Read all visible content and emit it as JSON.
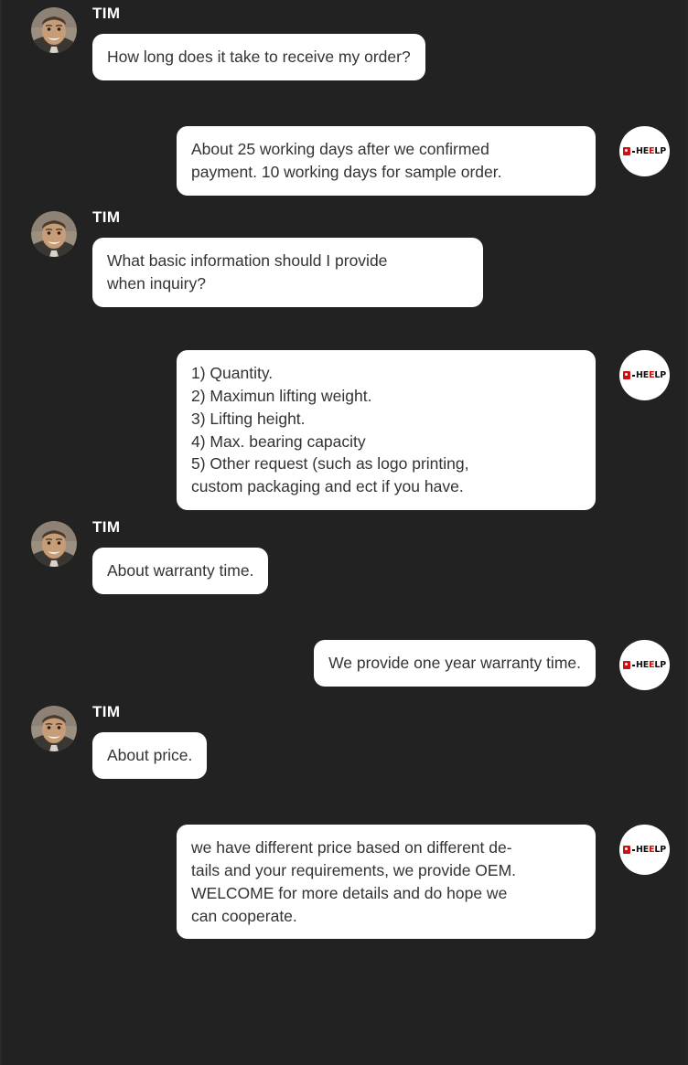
{
  "theme": {
    "background": "#222222",
    "bubble_background": "#ffffff",
    "bubble_text": "#333333",
    "sender_name_color": "#ffffff",
    "brand_accent": "#cc1111"
  },
  "brand": {
    "logo_text": "HEELP",
    "logo_accent_letter": "E",
    "logo_alt": "HEELP logo"
  },
  "conversation": [
    {
      "side": "incoming",
      "sender": "TIM",
      "avatar": "user-photo-avatar",
      "messages": [
        {
          "lines": [
            "How long does it take to receive my order?"
          ]
        }
      ]
    },
    {
      "side": "outgoing",
      "sender": "HEELP",
      "avatar": "brand-logo-avatar",
      "messages": [
        {
          "justified": true,
          "lines": [
            "About 25 working days after we confirmed",
            "payment. 10 working days for sample order."
          ]
        }
      ]
    },
    {
      "side": "incoming",
      "sender": "TIM",
      "avatar": "user-photo-avatar",
      "messages": [
        {
          "lines": [
            "What basic information should I provide",
            "when inquiry?"
          ]
        }
      ]
    },
    {
      "side": "outgoing",
      "sender": "HEELP",
      "avatar": "brand-logo-avatar",
      "messages": [
        {
          "lines": [
            "1) Quantity.",
            "2) Maximun lifting weight.",
            "3) Lifting height.",
            "4) Max. bearing capacity",
            "5) Other request (such as logo printing,",
            "custom packaging and ect if you have."
          ]
        }
      ]
    },
    {
      "side": "incoming",
      "sender": "TIM",
      "avatar": "user-photo-avatar",
      "messages": [
        {
          "lines": [
            "About warranty time."
          ]
        }
      ]
    },
    {
      "side": "outgoing",
      "sender": "HEELP",
      "avatar": "brand-logo-avatar",
      "messages": [
        {
          "lines": [
            "We provide one year warranty time."
          ]
        }
      ]
    },
    {
      "side": "incoming",
      "sender": "TIM",
      "avatar": "user-photo-avatar",
      "messages": [
        {
          "lines": [
            "About price."
          ]
        }
      ]
    },
    {
      "side": "outgoing",
      "sender": "HEELP",
      "avatar": "brand-logo-avatar",
      "messages": [
        {
          "justified": true,
          "lines": [
            "we have different price based on different de-",
            "tails and your requirements, we provide OEM.",
            "WELCOME for more details and do hope we",
            "can cooperate."
          ]
        }
      ]
    }
  ],
  "text": {
    "msg_1_l1": "How long does it take to receive my order?",
    "msg_2_l1": "About 25 working days after we confirmed",
    "msg_2_l2": "payment. 10 working days for sample order.",
    "msg_3_l1": "What basic information should I provide",
    "msg_3_l2": "when inquiry?",
    "msg_4_l1": "1) Quantity.",
    "msg_4_l2": "2) Maximun lifting weight.",
    "msg_4_l3": "3) Lifting height.",
    "msg_4_l4": "4) Max. bearing capacity",
    "msg_4_l5": "5) Other request (such as logo printing,",
    "msg_4_l6": "custom packaging and ect if you have.",
    "msg_5_l1": "About warranty time.",
    "msg_6_l1": "We provide one year warranty time.",
    "msg_7_l1": "About price.",
    "msg_8_l1": "we have different price based on different de-",
    "msg_8_l2": "tails and your requirements, we provide OEM.",
    "msg_8_l3": "WELCOME for more details and do hope we",
    "msg_8_l4": "can cooperate.",
    "sender_tim": "TIM"
  }
}
